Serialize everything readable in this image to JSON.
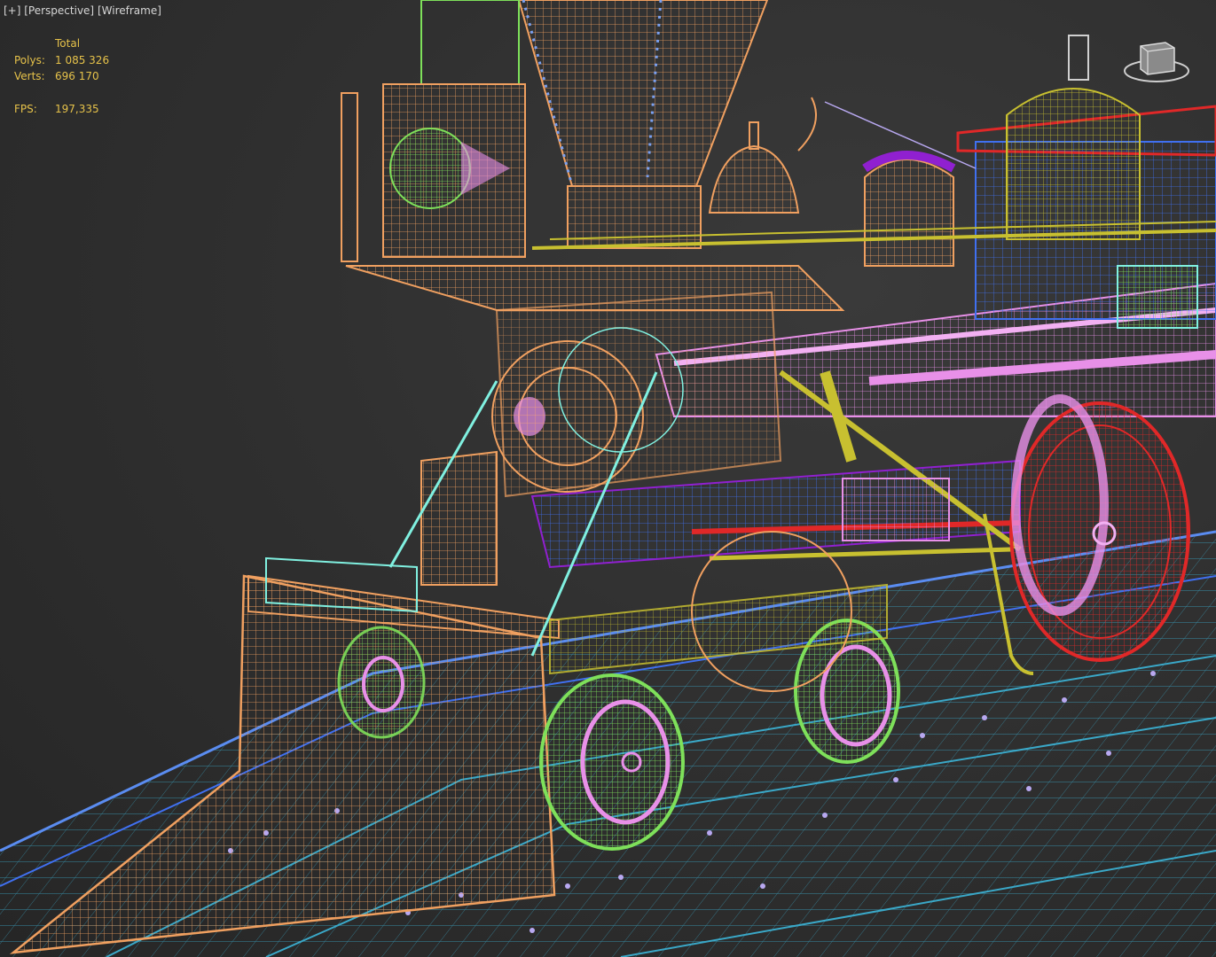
{
  "viewport": {
    "labels": [
      "[+]",
      "[Perspective]",
      "[Wireframe]"
    ]
  },
  "stats": {
    "header": "Total",
    "polys_label": "Polys:",
    "polys_value": "1 085 326",
    "verts_label": "Verts:",
    "verts_value": "696 170",
    "fps_label": "FPS:",
    "fps_value": "197,335"
  },
  "colors": {
    "background": "#303030",
    "stats_text": "#e6c24a",
    "label_text": "#d6d6d6",
    "orange": "#f0a060",
    "pink": "#e890e8",
    "red": "#e02828",
    "green": "#7ee05a",
    "cyan": "#80f0e0",
    "blue": "#4070f0",
    "purple": "#9020d0",
    "yellow": "#c8c030",
    "track": "#3aa8c8"
  },
  "icons": {
    "viewcube": "viewcube-icon"
  }
}
